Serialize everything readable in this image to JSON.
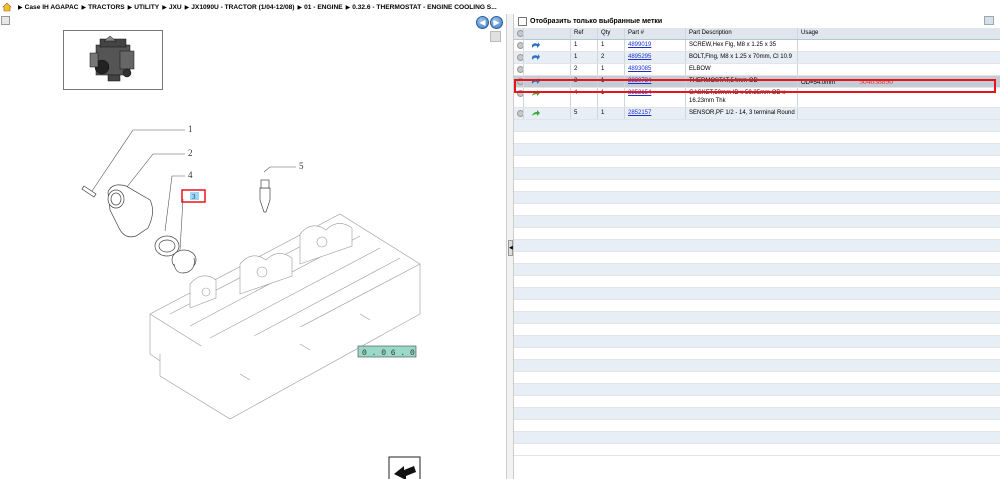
{
  "breadcrumb": [
    "Case IH AGAPAC",
    "TRACTORS",
    "UTILITY",
    "JXU",
    "JX1090U - TRACTOR (1/04-12/08)",
    "01 - ENGINE",
    "0.32.6 - THERMOSTAT - ENGINE COOLING S..."
  ],
  "filter": {
    "label": "Отобразить только выбранные метки"
  },
  "table": {
    "headers": {
      "ref": "Ref",
      "qty": "Qty",
      "part": "Part #",
      "desc": "Part Description",
      "usage": "Usage"
    },
    "rows": [
      {
        "ref": "1",
        "qty": "1",
        "part": "4899019",
        "desc": "SCREW,Hex Flg, M8 x 1.25 x 35",
        "usage": "",
        "extra": "",
        "icon": "blue-arrow-icon"
      },
      {
        "ref": "1",
        "qty": "2",
        "part": "4895295",
        "desc": "BOLT,Flng, M8 x 1.25 x 70mm, Cl 10.9",
        "usage": "",
        "extra": "",
        "icon": "blue-arrow-icon"
      },
      {
        "ref": "2",
        "qty": "1",
        "part": "4893085",
        "desc": "ELBOW",
        "usage": "",
        "extra": "",
        "icon": ""
      },
      {
        "ref": "3",
        "qty": "1",
        "part": "2830734",
        "desc": "THERMOSTAT,54mm OD",
        "usage": "OD=54.0mm",
        "extra": "504038890",
        "icon": "blue-arrow-icon"
      },
      {
        "ref": "4",
        "qty": "1",
        "part": "2852154",
        "desc": "GASKET,50mm ID x 59.25mm OD x 16.23mm Thk",
        "usage": "",
        "extra": "",
        "icon": "green-arrow-icon"
      },
      {
        "ref": "5",
        "qty": "1",
        "part": "2852157",
        "desc": "SENSOR,PF 1/2 - 14, 3 terminal Round",
        "usage": "",
        "extra": "",
        "icon": "green-arrow-icon"
      }
    ]
  },
  "diagram": {
    "callouts": [
      "1",
      "2",
      "4",
      "3",
      "5"
    ],
    "figure_code": "0 . 0 6 . 0"
  },
  "colors": {
    "highlight": "#e8141b",
    "link": "#1a2fd0",
    "row_alt": "#e8eef5",
    "header": "#dfe6ee"
  }
}
